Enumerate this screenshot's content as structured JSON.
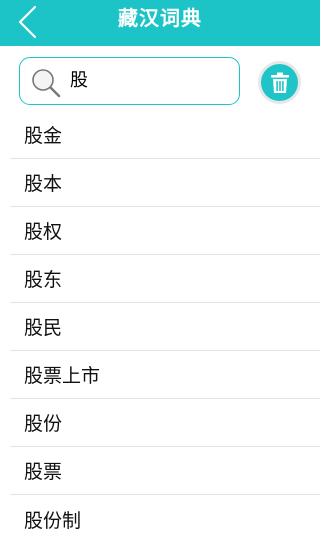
{
  "header": {
    "title": "藏汉词典",
    "back_icon": "chevron-left-icon"
  },
  "search": {
    "value": "股",
    "icon": "search-icon"
  },
  "delete_button": {
    "icon": "trash-icon"
  },
  "colors": {
    "accent": "#1cc4c8",
    "divider": "#e3e3e3",
    "text": "#111111"
  },
  "results": [
    {
      "label": "股金"
    },
    {
      "label": "股本"
    },
    {
      "label": "股权"
    },
    {
      "label": "股东"
    },
    {
      "label": "股民"
    },
    {
      "label": "股票上市"
    },
    {
      "label": "股份"
    },
    {
      "label": "股票"
    },
    {
      "label": "股份制"
    }
  ]
}
